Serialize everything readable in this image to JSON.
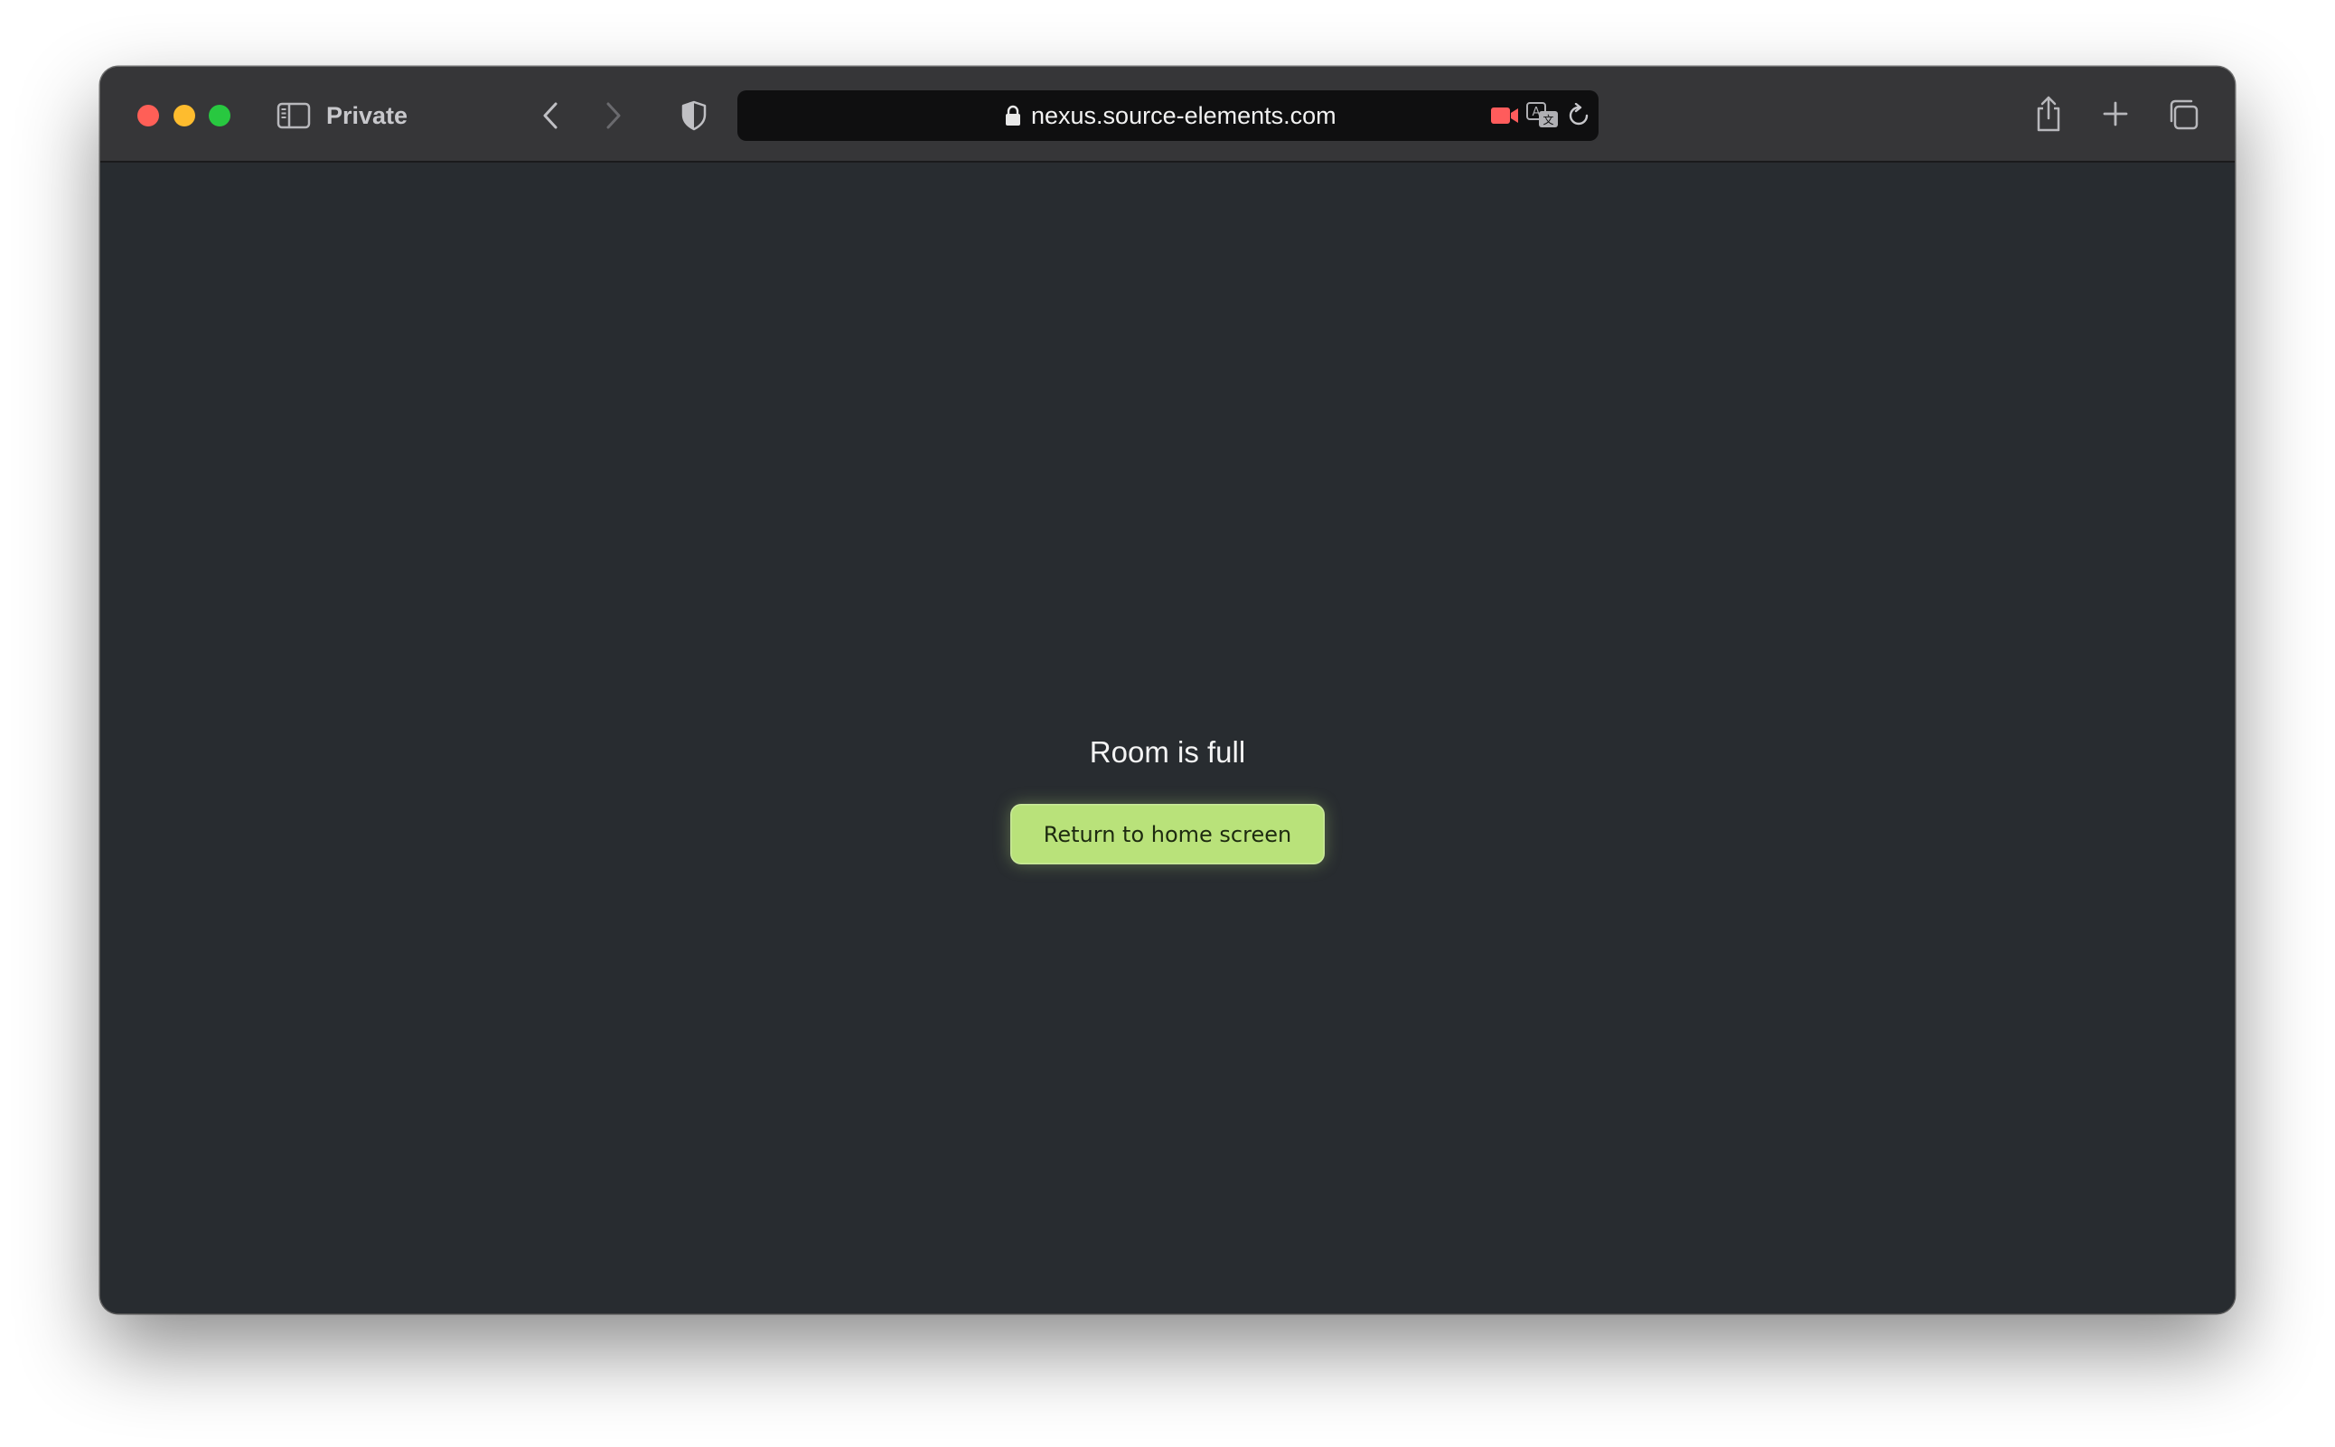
{
  "browser": {
    "mode_label": "Private",
    "url": "nexus.source-elements.com"
  },
  "page": {
    "message": "Room is full",
    "button_label": "Return to home screen"
  },
  "colors": {
    "accent": "#b9e27a",
    "background": "#282c30",
    "camera_indicator": "#ff5c5c"
  }
}
